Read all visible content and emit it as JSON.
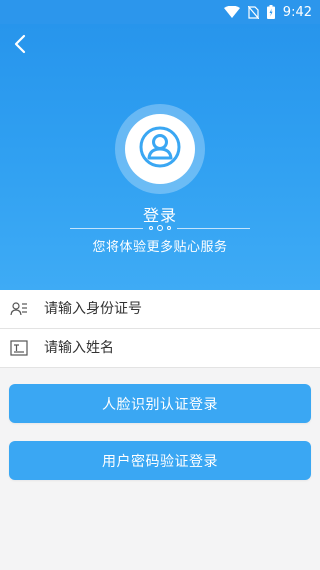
{
  "status_bar": {
    "time": "9:42",
    "icons": [
      "wifi-icon",
      "no-sim-icon",
      "battery-charging-icon"
    ]
  },
  "header": {
    "back_icon": "back-arrow-icon",
    "avatar_icon": "user-avatar-icon",
    "title": "登录",
    "subtitle": "您将体验更多贴心服务"
  },
  "form": {
    "id_field": {
      "icon": "id-card-icon",
      "placeholder": "请输入身份证号",
      "value": ""
    },
    "name_field": {
      "icon": "name-tag-icon",
      "placeholder": "请输入姓名",
      "value": ""
    }
  },
  "buttons": {
    "face_login": "人脸识别认证登录",
    "password_login": "用户密码验证登录"
  },
  "colors": {
    "header_top": "#2795ec",
    "header_bottom": "#3eabf5",
    "button": "#3aa7f3",
    "background": "#f4f4f5"
  }
}
